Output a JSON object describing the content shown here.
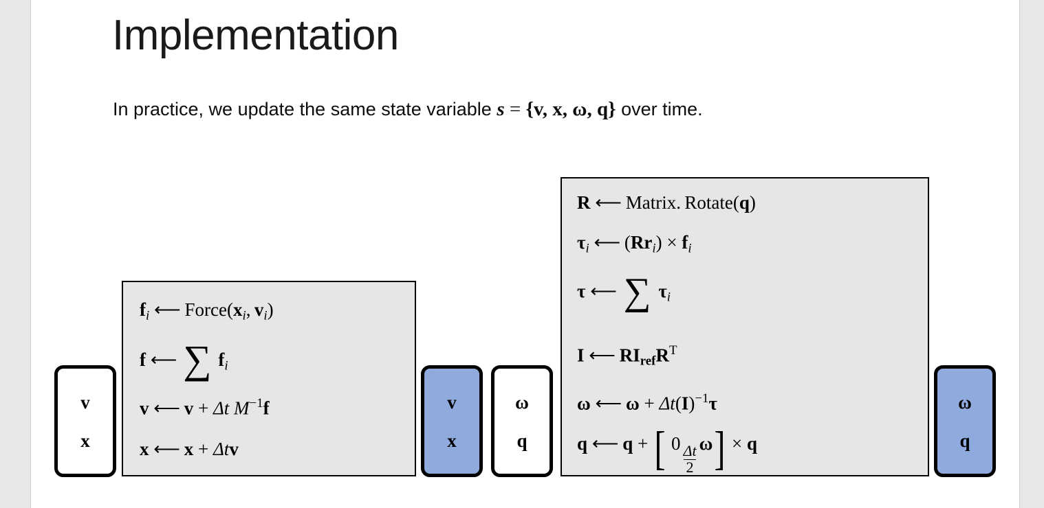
{
  "slide": {
    "title": "Implementation",
    "subtitle": {
      "lead": "In practice, we update the same state variable ",
      "state_symbol": "s",
      "equals": " = ",
      "open_brace": "{",
      "members": "v, x, ω, q",
      "close_brace": "}",
      "trail": " over time."
    }
  },
  "state_boxes": [
    {
      "name": "linear-state-input",
      "symbols": [
        "v",
        "x"
      ],
      "fill": "#ffffff",
      "highlighted": false
    },
    {
      "name": "linear-state-output",
      "symbols": [
        "v",
        "x"
      ],
      "fill": "#8faadc",
      "highlighted": true
    },
    {
      "name": "angular-state-input",
      "symbols": "ω,q",
      "symbol_top": "ω",
      "symbol_bottom": "q",
      "fill": "#ffffff",
      "highlighted": false
    },
    {
      "name": "angular-state-output",
      "symbol_top": "ω",
      "symbol_bottom": "q",
      "fill": "#8faadc",
      "highlighted": true
    }
  ],
  "linear_panel": {
    "name": "linear-dynamics-panel",
    "fill": "#e6e6e6",
    "equations": [
      {
        "id": "force-per-particle",
        "text": "f_i ⟵ Force(x_i, v_i)"
      },
      {
        "id": "total-force",
        "text": "f ⟵ ∑ f_i"
      },
      {
        "id": "velocity-update",
        "text": "v ⟵ v + Δt M⁻¹ f"
      },
      {
        "id": "position-update",
        "text": "x ⟵ x + Δt v"
      }
    ]
  },
  "rotational_panel": {
    "name": "rotational-dynamics-panel",
    "fill": "#e6e6e6",
    "equations": [
      {
        "id": "rotation-matrix",
        "text": "R ⟵ Matrix.Rotate(q)"
      },
      {
        "id": "torque-per-particle",
        "text": "τ_i ⟵ (R r_i) × f_i"
      },
      {
        "id": "total-torque",
        "text": "τ ⟵ ∑ τ_i"
      },
      {
        "id": "inertia-tensor",
        "text": "I ⟵ R I_ref Rᵀ"
      },
      {
        "id": "angular-velocity-update",
        "text": "ω ⟵ ω + Δt(I)⁻¹ τ"
      },
      {
        "id": "quaternion-update",
        "text": "q ⟵ q + [0  (Δt/2)ω] × q"
      }
    ]
  },
  "glyphs": {
    "arrow_left": "⟵",
    "sigma": "∑",
    "times": "×",
    "delta": "Δ",
    "omega": "ω",
    "tau": "τ",
    "bracket_left": "[",
    "bracket_right": "]",
    "plus": "+",
    "zero": "0",
    "two": "2",
    "t": "t",
    "M": "M",
    "minus_one": "−1",
    "T_transpose": "T",
    "ref": "ref",
    "i_index": "i",
    "paren_left": "(",
    "paren_right": ")",
    "comma": ",",
    "force_name": "Force",
    "matrix_rotate_name": "Matrix. Rotate",
    "f": "f",
    "v": "v",
    "x": "x",
    "q": "q",
    "R": "R",
    "r": "r",
    "I": "I",
    "s": "s"
  }
}
